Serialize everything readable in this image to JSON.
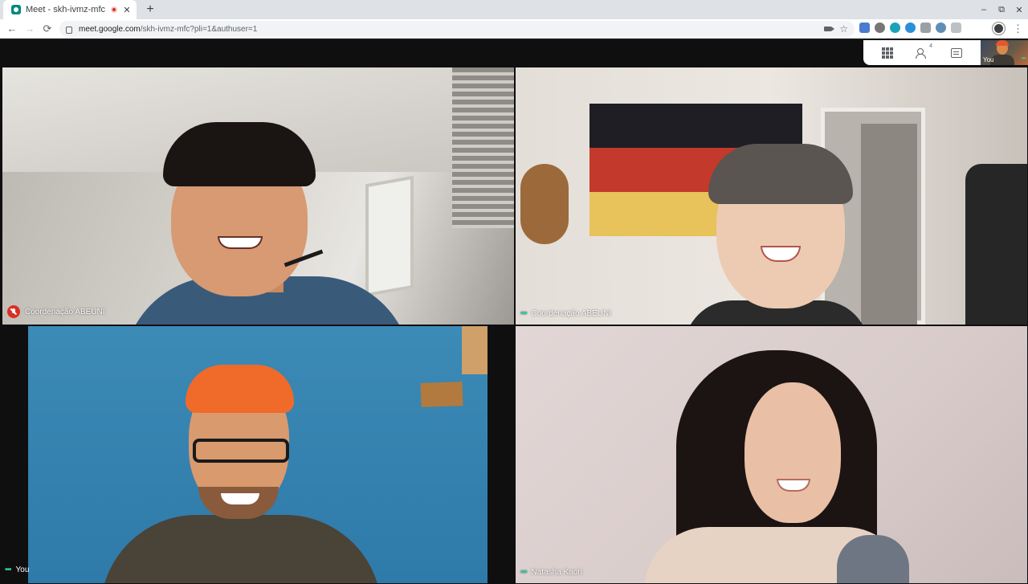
{
  "browser": {
    "tab_title": "Meet - skh-ivmz-mfc",
    "tab_close": "✕",
    "new_tab": "+",
    "window_controls": {
      "minimize": "–",
      "restore": "⧉",
      "close": "✕"
    },
    "nav": {
      "back": "←",
      "forward": "→",
      "reload": "⟳"
    },
    "url_host": "meet.google.com",
    "url_path": "/skh-ivmz-mfc?pli=1&authuser=1",
    "menu": "⋮"
  },
  "meet": {
    "people_count": "4",
    "self_view_label": "You",
    "tiles": [
      {
        "name": "Coordenação ABEUNI",
        "status": "muted"
      },
      {
        "name": "Coordenação ABEUNI",
        "status": "speaking"
      },
      {
        "name": "You",
        "status": "speaking"
      },
      {
        "name": "Natasha Kaori",
        "status": "speaking"
      }
    ],
    "status_glyph": "•••"
  },
  "colors": {
    "accent_teal": "#34c9a5",
    "mute_red": "#d93025",
    "background": "#0f0f10"
  }
}
